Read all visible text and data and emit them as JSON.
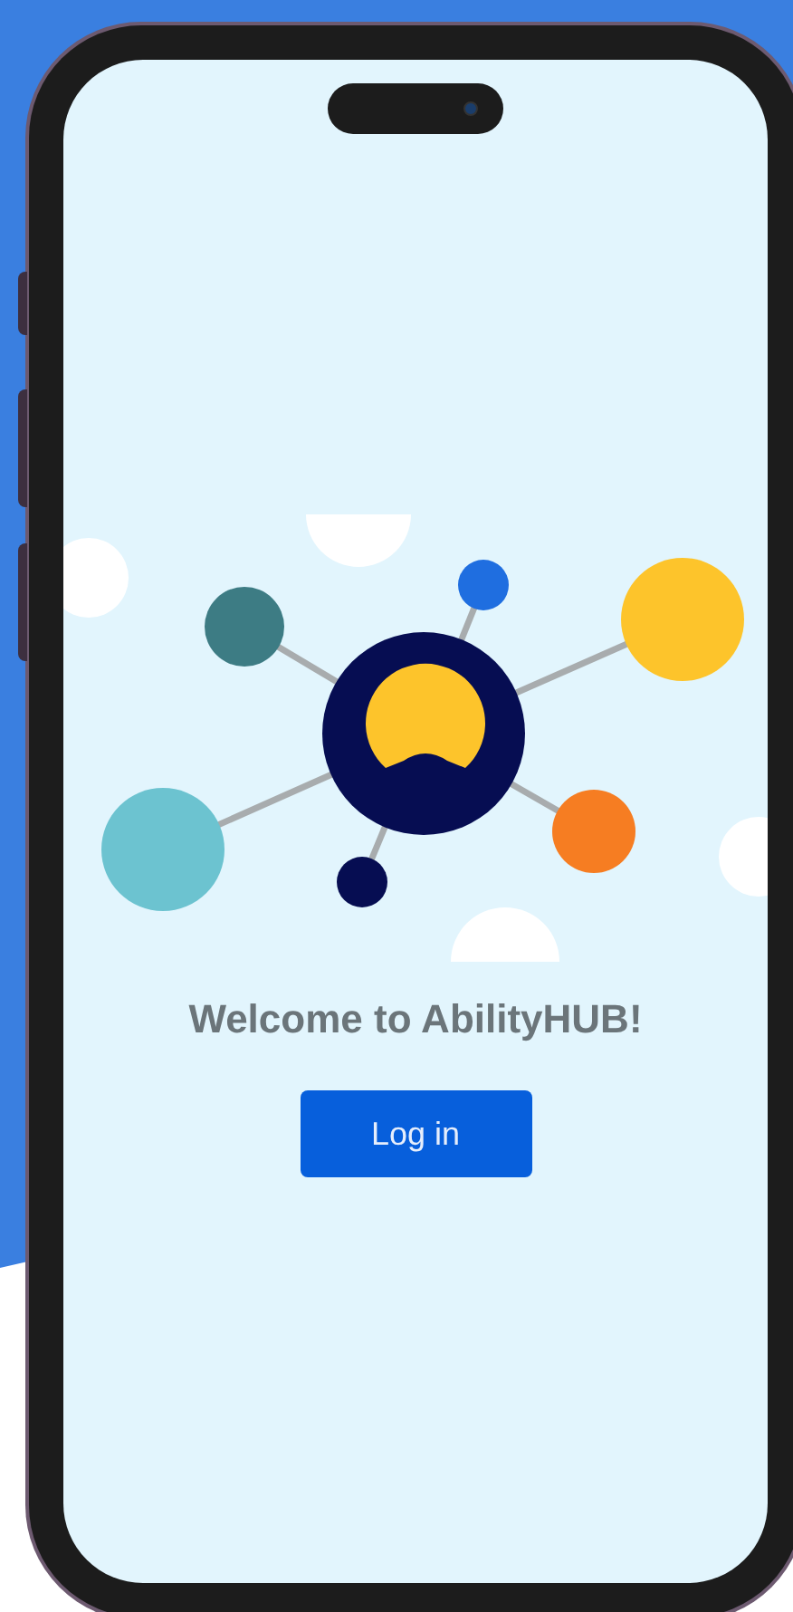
{
  "screen": {
    "welcome": "Welcome to AbilityHUB!",
    "login_button": "Log in"
  }
}
